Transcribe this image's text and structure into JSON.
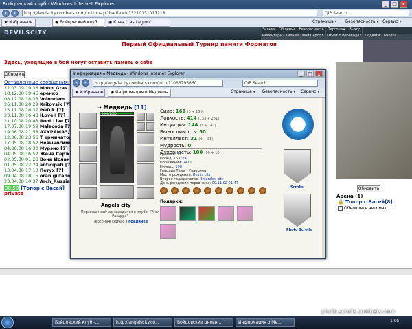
{
  "browser": {
    "title": "Бойцовский клуб - Windows Internet Explorer",
    "url": "http://devilscity.combats.com/buttons.pl?battle=0.13210131017218",
    "search_placeholder": "QIP Search",
    "favorites": "Избранное",
    "tabs": [
      {
        "label": "Бойцовский клуб"
      },
      {
        "label": "Клан \"LastLegion\""
      }
    ],
    "toolbar": [
      "Страница",
      "Безопасность",
      "Сервис"
    ]
  },
  "game": {
    "logo": "DEVILSCITY",
    "top_menu": [
      "Знания",
      "Общение",
      "Безопасность",
      "Персонаж",
      "Выход"
    ],
    "sub_menu": [
      "Инвентарь",
      "Умения",
      "Мой Скролл",
      "Отчет о переводах",
      "Подвиги",
      "Анкета"
    ],
    "heading": "Первый Официальный Турнир памяти Форматов",
    "chat_header": "Здесь, уходящие в бой могут оставить память о себе",
    "refresh_label": "Обновить",
    "messages_label": "Оставленные сообщения: 1",
    "chat_rows": [
      {
        "t": "22.03.09 19:38",
        "n": "Moon_Gras"
      },
      {
        "t": "18.12.08 19:46",
        "n": "epeнко"
      },
      {
        "t": "08.12.08 18:33",
        "n": "Volondem"
      },
      {
        "t": "26.11.08 20:29",
        "n": "Kritovsik [7]"
      },
      {
        "t": "23.11.08 16:37",
        "n": "PODik [7]"
      },
      {
        "t": "23.11.08 16:43",
        "n": "ILoveII [7]"
      },
      {
        "t": "21.10.08 20:43",
        "n": "Root Live [7]"
      },
      {
        "t": "17.07.08 19:59",
        "n": "Malacoda [7]"
      },
      {
        "t": "19.06.08 21:58",
        "n": "АХУРАМАЗДА"
      },
      {
        "t": "12.06.08 23:56",
        "n": "Т ерминатор"
      },
      {
        "t": "17.05.08 18:52",
        "n": "Невыносимо"
      },
      {
        "t": "04.06.08 16:30",
        "n": "Мурэно [7]"
      },
      {
        "t": "04.05.08 16:52",
        "n": "Жена Серж"
      },
      {
        "t": "02.05.08 01:28",
        "n": "Вони Ислан"
      },
      {
        "t": "01.05.08 22:24",
        "n": "anticipati [7]"
      },
      {
        "t": "13.04.08 17:13",
        "n": "Петух [7]"
      },
      {
        "t": "09.04.08 18:15",
        "n": "oran gutano"
      },
      {
        "t": "23.04.08 10:37",
        "n": "Arch_Russia"
      }
    ],
    "chat_highlight": {
      "time": "00:58",
      "name": "[Топор с Васей]",
      "private": "private"
    },
    "refresh_label_2": "Обновить",
    "arena_label": "Арена (1)",
    "arena_user": "Топор с Васей[8]",
    "auto_update": "Обновлять автомат.",
    "watermark": "photo.scrolls.combats.com"
  },
  "popup": {
    "title": "Информация о Медведь - Windows Internet Explorer",
    "url": "http://angelscity.combats.com/inf.pl?1036795660",
    "search_placeholder": "QIP Search",
    "favorites": "Избранное",
    "tab": "Информация о Медведь",
    "toolbar": [
      "Страница",
      "Безопасность",
      "Сервис"
    ],
    "character": {
      "name": "Медведь",
      "level": "[11]",
      "hp": "2000/2000"
    },
    "stats": [
      {
        "label": "Сила:",
        "value": "161",
        "detail": "(3 + 158)"
      },
      {
        "label": "Ловкость:",
        "value": "414",
        "detail": "(133 + 281)"
      },
      {
        "label": "Интуиция:",
        "value": "144",
        "detail": "(3 + 141)"
      },
      {
        "label": "Выносливость:",
        "value": "50",
        "detail": ""
      },
      {
        "label": "Интеллект:",
        "value": "31",
        "detail": "(0 + 31)"
      },
      {
        "label": "Мудрость:",
        "value": "0",
        "detail": ""
      },
      {
        "label": "Духовность:",
        "value": "100",
        "detail": "(90 + 10)"
      }
    ],
    "info": [
      {
        "label": "Уровень:",
        "value": "11"
      },
      {
        "label": "Побед:",
        "value": "153124"
      },
      {
        "label": "Поражений:",
        "value": "2411"
      },
      {
        "label": "Ничьих:",
        "value": "198"
      },
      {
        "label": "Гвардия Тьмы - Гвардеец",
        "value": ""
      },
      {
        "label": "Место рождения:",
        "value": "Devils city"
      },
      {
        "label": "Второе гражданство:",
        "value": "Emeralds city"
      },
      {
        "label": "День рождения персонажа:",
        "value": "09.11.02 01:47"
      }
    ],
    "city": "Angels city",
    "status1": "Персонаж сейчас находится в клубе. \"Угол Разарра\"",
    "status2_prefix": "Персонаж сейчас в",
    "status2_link": "поединке",
    "gifts_label": "Подарки:",
    "scrolls_label": "Scrolls",
    "photo_label": "Photo Scrolls"
  },
  "taskbar": [
    {
      "label": "Бойцовский клуб -..."
    },
    {
      "label": "http://angelscity.co..."
    },
    {
      "label": "Бойцовские дневн..."
    },
    {
      "label": "Информация о Ме..."
    }
  ],
  "clock": "1:05"
}
